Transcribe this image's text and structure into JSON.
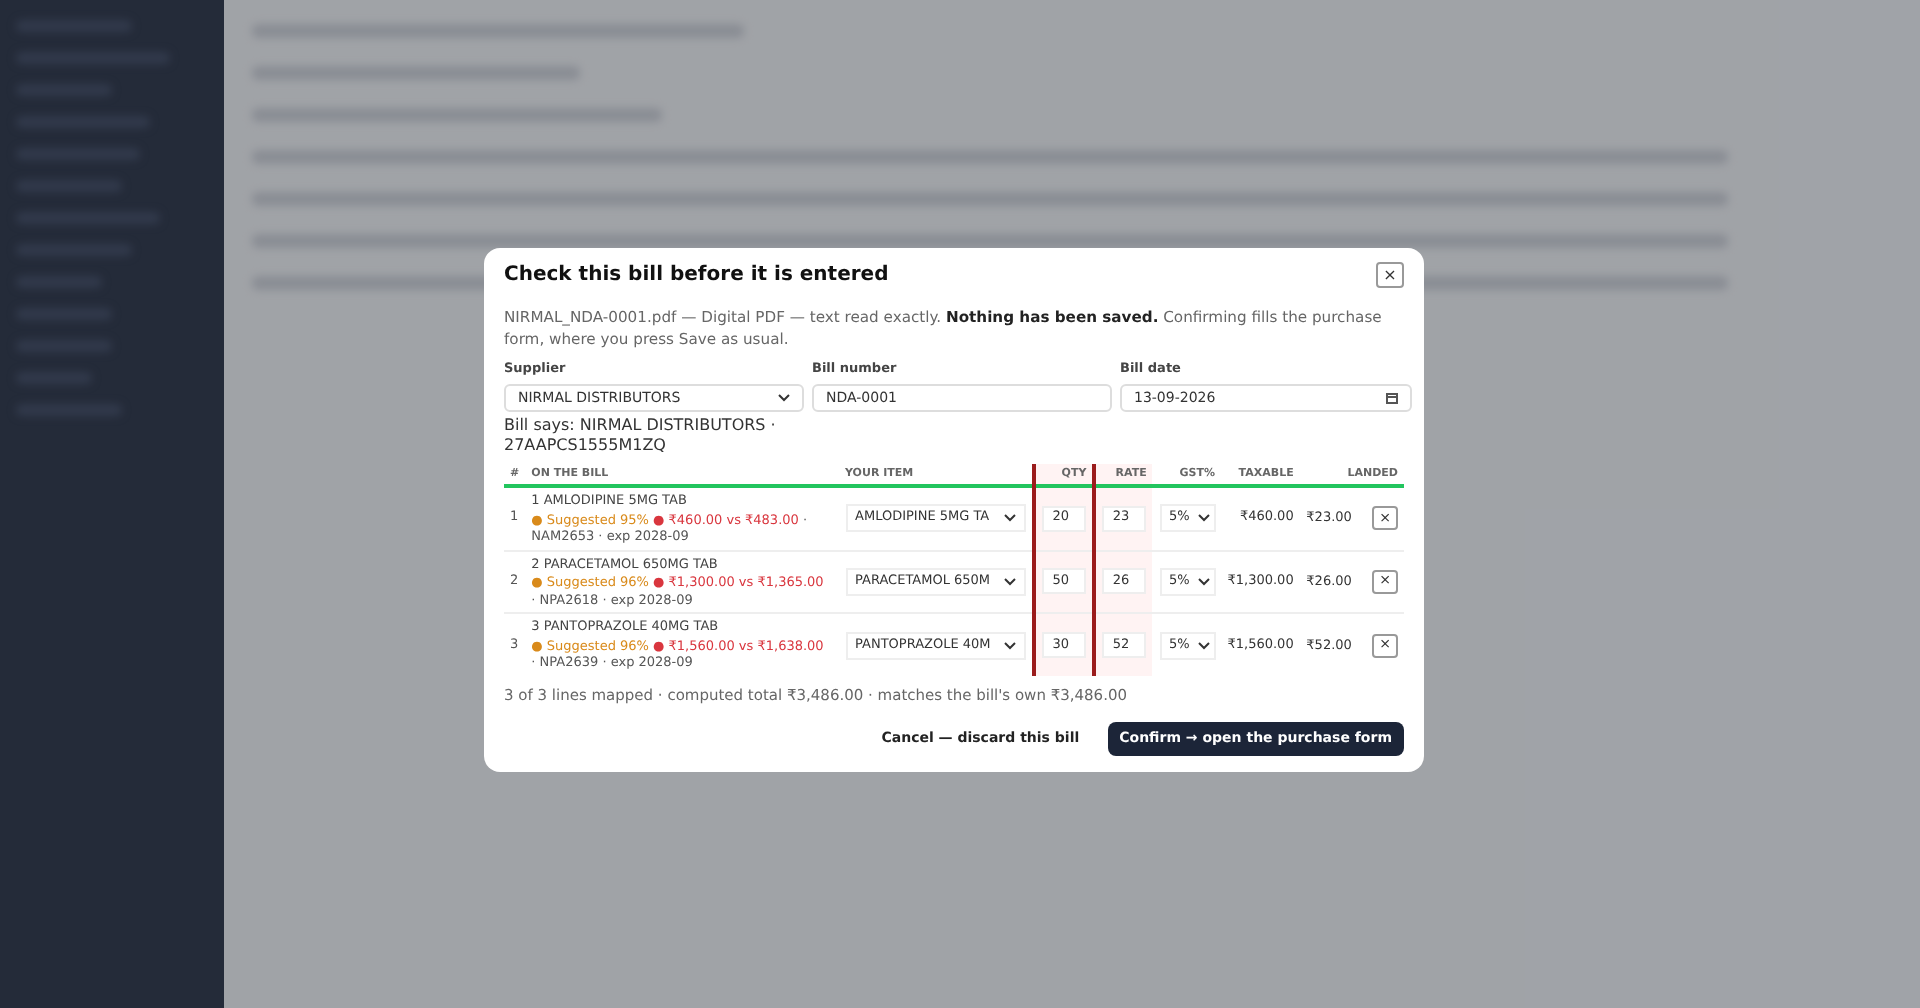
{
  "dialog": {
    "title": "Check this bill before it is entered",
    "close": "×",
    "intro": "NIRMAL_NDA-0001.pdf — Digital PDF — text read exactly. **Nothing has been saved.** Confirming fills the purchase form, where you press Save as usual.",
    "fields": [
      {
        "label": "Supplier",
        "kind": "select",
        "value": "NIRMAL DISTRIBUTORS"
      },
      {
        "label": "Bill number",
        "kind": "text",
        "value": "NDA-0001"
      },
      {
        "label": "Bill date",
        "kind": "date",
        "value": "13-09-2026"
      }
    ],
    "bill_says": "Bill says: NIRMAL DISTRIBUTORS · 27AAPCS1555M1ZQ",
    "columns": [
      {
        "label": "#",
        "flagged": false
      },
      {
        "label": "ON THE BILL",
        "flagged": false
      },
      {
        "label": "YOUR ITEM",
        "flagged": false
      },
      {
        "label": "QTY",
        "flagged": true
      },
      {
        "label": "RATE",
        "flagged": true
      },
      {
        "label": "GST%",
        "flagged": false
      },
      {
        "label": "TAXABLE",
        "flagged": false
      },
      {
        "label": "LANDED",
        "flagged": false
      }
    ],
    "rows": [
      {
        "index": "1",
        "name": "1 AMLODIPINE 5MG TAB",
        "suggestion": "● Suggested 95%",
        "price_check": "● ₹460.00 vs ₹483.00",
        "meta": "· NAM2653 · exp 2028-09",
        "item": "AMLODIPINE 5MG TA",
        "qty": "20",
        "rate": "23",
        "gst": "5%",
        "taxable": "₹460.00",
        "landed": "₹23.00",
        "remove": "×"
      },
      {
        "index": "2",
        "name": "2 PARACETAMOL 650MG TAB",
        "suggestion": "● Suggested 96%",
        "price_check": "● ₹1,300.00 vs ₹1,365.00",
        "meta": "· NPA2618 · exp 2028-09",
        "item": "PARACETAMOL 650M",
        "qty": "50",
        "rate": "26",
        "gst": "5%",
        "taxable": "₹1,300.00",
        "landed": "₹26.00",
        "remove": "×"
      },
      {
        "index": "3",
        "name": "3 PANTOPRAZOLE 40MG TAB",
        "suggestion": "● Suggested 96%",
        "price_check": "● ₹1,560.00 vs ₹1,638.00",
        "meta": "· NPA2639 · exp 2028-09",
        "item": "PANTOPRAZOLE 40M",
        "qty": "30",
        "rate": "52",
        "gst": "5%",
        "taxable": "₹1,560.00",
        "landed": "₹52.00",
        "remove": "×"
      }
    ],
    "summary": {
      "text": "3 of 3 lines mapped · computed total ₹3,486.00 · matches the bill's own ₹3,486.00",
      "matches": true
    },
    "buttons": [
      {
        "label": "Cancel — discard this bill",
        "kind": "secondary"
      },
      {
        "label": "Confirm → open the purchase form",
        "kind": "primary"
      }
    ]
  }
}
